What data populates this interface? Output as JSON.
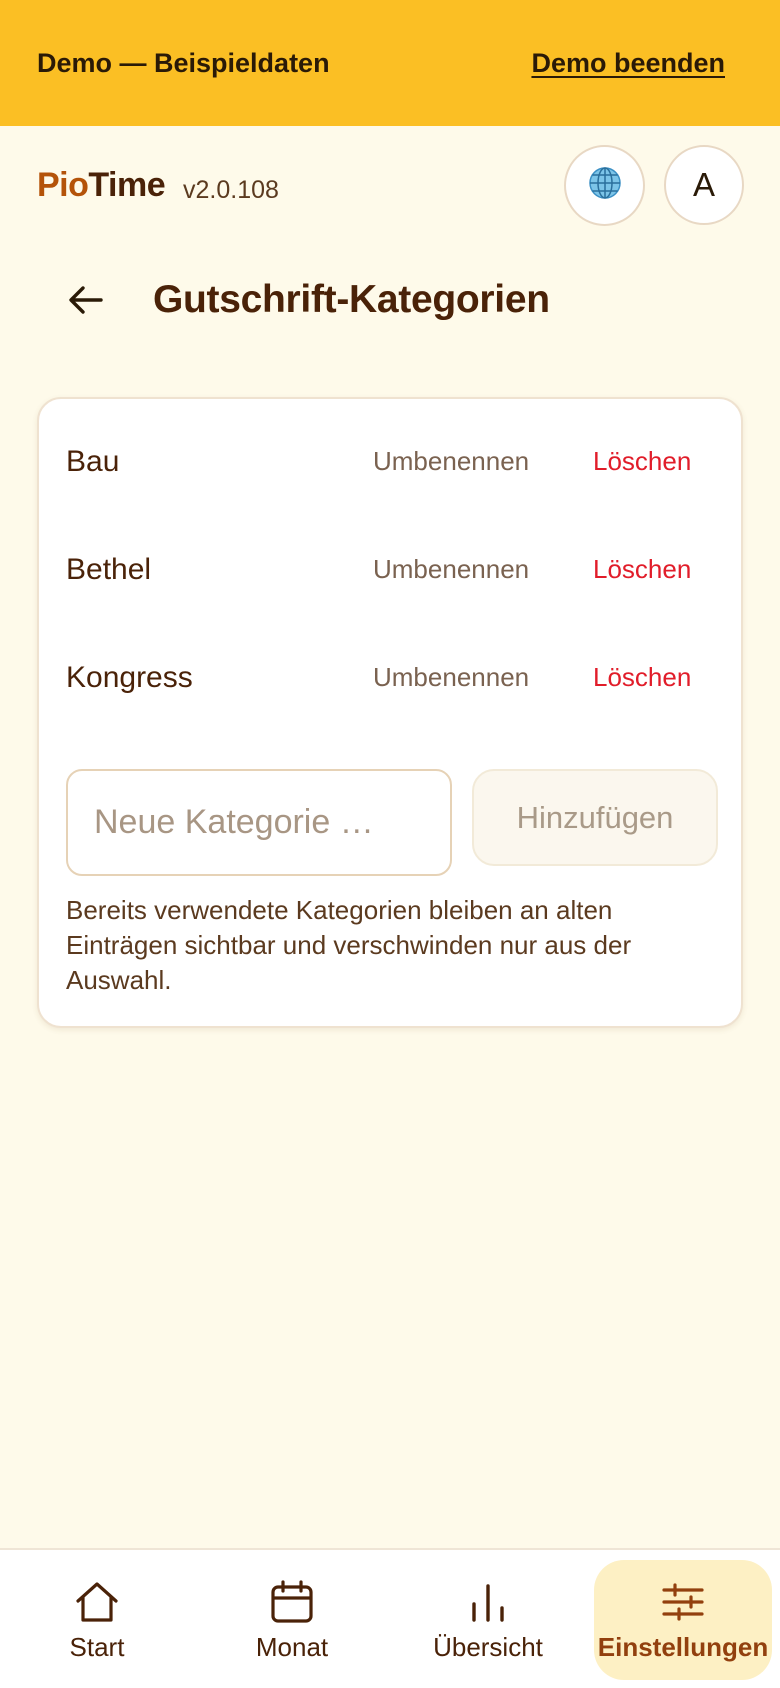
{
  "demo_banner": {
    "text": "Demo — Beispieldaten",
    "end_label": "Demo beenden"
  },
  "header": {
    "logo_part1": "Pio",
    "logo_part2": "Time",
    "version": "v2.0.108",
    "globe_icon": "🌐",
    "avatar_letter": "A"
  },
  "page": {
    "title": "Gutschrift-Kategorien"
  },
  "categories": [
    {
      "name": "Bau",
      "rename_label": "Umbenennen",
      "delete_label": "Löschen"
    },
    {
      "name": "Bethel",
      "rename_label": "Umbenennen",
      "delete_label": "Löschen"
    },
    {
      "name": "Kongress",
      "rename_label": "Umbenennen",
      "delete_label": "Löschen"
    }
  ],
  "new_category": {
    "placeholder": "Neue Kategorie …",
    "value": "",
    "add_label": "Hinzufügen"
  },
  "hint": "Bereits verwendete Kategorien bleiben an alten Einträgen sichtbar und verschwinden nur aus der Auswahl.",
  "nav": {
    "items": [
      {
        "label": "Start",
        "icon": "home-icon"
      },
      {
        "label": "Monat",
        "icon": "calendar-icon"
      },
      {
        "label": "Übersicht",
        "icon": "bar-chart-icon"
      },
      {
        "label": "Einstellungen",
        "icon": "sliders-icon",
        "active": true
      }
    ]
  },
  "colors": {
    "banner": "#fbbf24",
    "background": "#fefaea",
    "accent": "#b45309",
    "danger": "#e11d2a",
    "active_nav_bg": "#fdf0c4"
  }
}
